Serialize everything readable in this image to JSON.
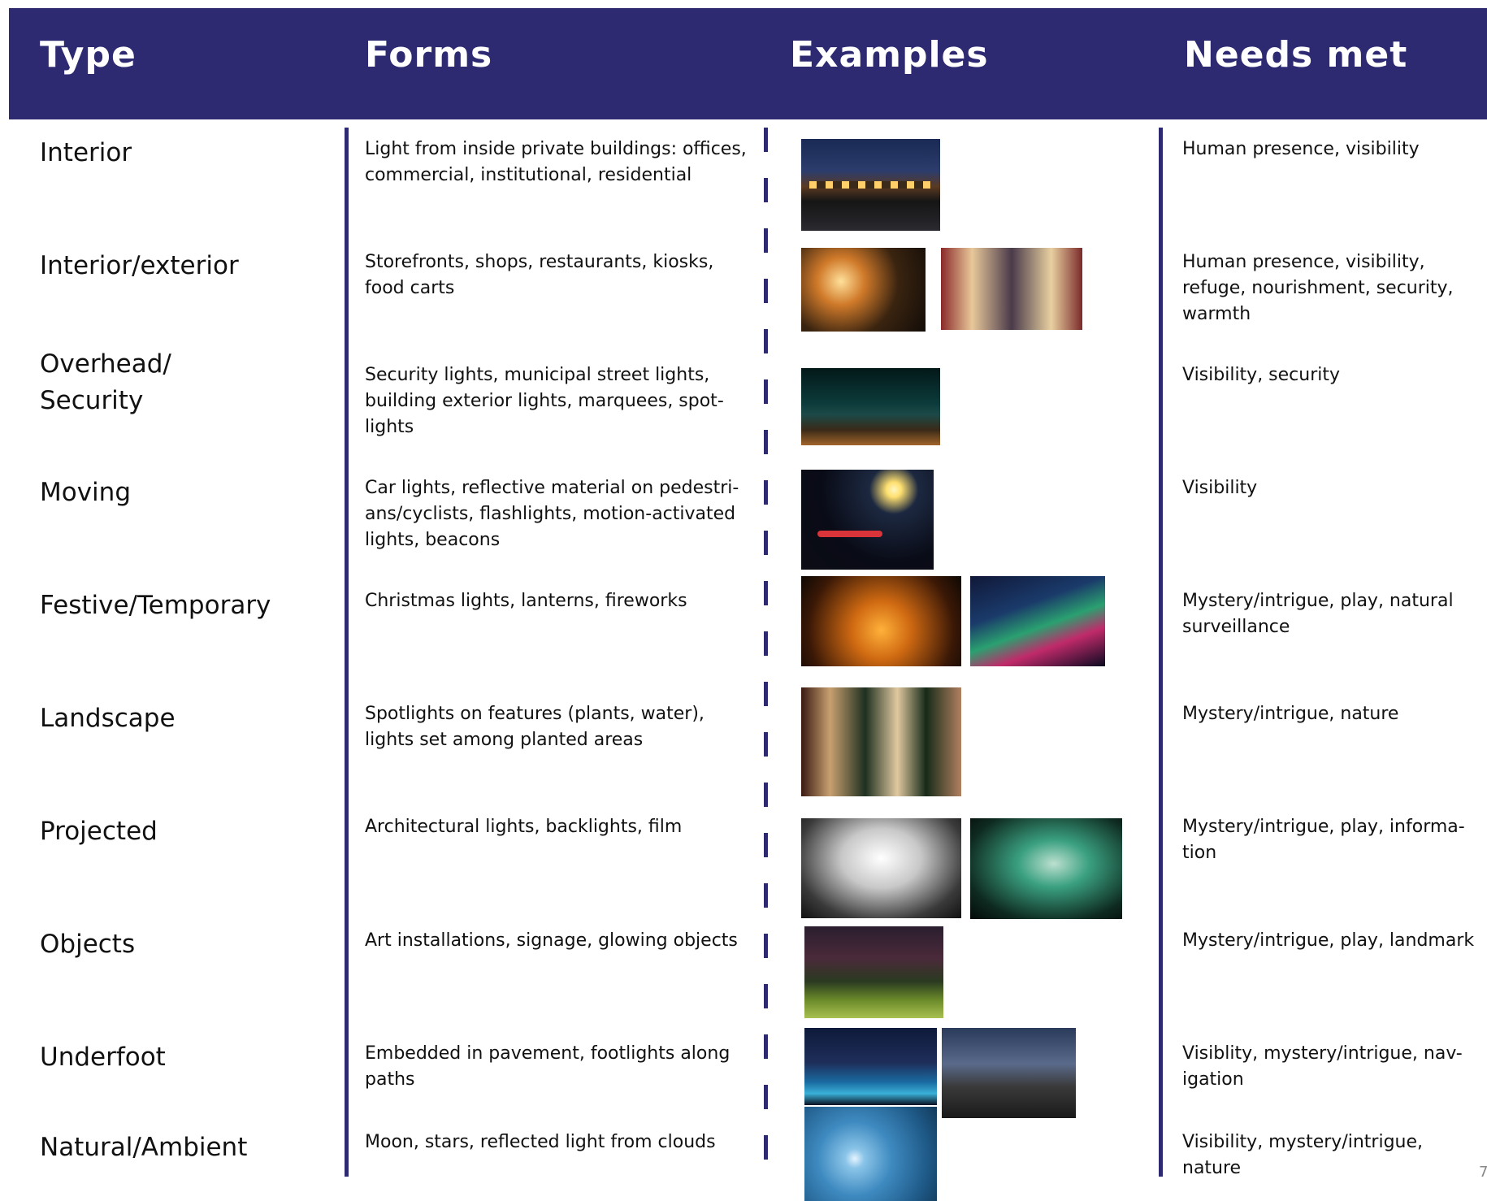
{
  "headers": {
    "type": "Type",
    "forms": "Forms",
    "examples": "Examples",
    "needs": "Needs met"
  },
  "rows": [
    {
      "type": "Interior",
      "forms": "Light from inside private buildings: offices, commercial, institutional, residential",
      "needs": "Human presence, visibility"
    },
    {
      "type": "Interior/exterior",
      "forms": "Storefronts, shops, restaurants, kiosks, food carts",
      "needs": "Human presence, visibility, refuge, nourishment, security, warmth"
    },
    {
      "type": "Overhead/\nSecurity",
      "forms": "Security lights, municipal street lights, building exterior lights, marquees, spot-lights",
      "needs": "Visibility, security"
    },
    {
      "type": "Moving",
      "forms": "Car lights, reflective material on pedestri-ans/cyclists, flashlights, motion-activated lights, beacons",
      "needs": "Visibility"
    },
    {
      "type": "Festive/Temporary",
      "forms": "Christmas lights, lanterns, fireworks",
      "needs": "Mystery/intrigue, play, natural surveillance"
    },
    {
      "type": "Landscape",
      "forms": "Spotlights on features (plants, water), lights set among planted areas",
      "needs": "Mystery/intrigue, nature"
    },
    {
      "type": "Projected",
      "forms": "Architectural lights, backlights, film",
      "needs": "Mystery/intrigue, play, informa-tion"
    },
    {
      "type": "Objects",
      "forms": "Art installations, signage, glowing objects",
      "needs": "Mystery/intrigue, play, landmark"
    },
    {
      "type": "Underfoot",
      "forms": "Embedded in pavement, footlights along paths",
      "needs": "Visiblity, mystery/intrigue, nav-igation"
    },
    {
      "type": "Natural/Ambient",
      "forms": "Moon, stars, reflected light from clouds",
      "needs": "Visibility, mystery/intrigue, nature"
    }
  ],
  "photo_icons": [
    "night-street-photo",
    "food-cart-photo",
    "shopping-street-photo",
    "street-lights-photo",
    "car-headlights-photo",
    "sky-lanterns-photo",
    "light-tunnel-photo",
    "lit-birch-forest-photo",
    "projected-hands-photo",
    "projected-statue-photo",
    "glowing-reeds-photo",
    "glowing-path-photo",
    "ground-lights-photo",
    "moonlit-sky-photo"
  ],
  "colors": {
    "header_bg": "#2d2a72",
    "header_text": "#ffffff",
    "divider": "#2d2a72"
  },
  "page_number": "7"
}
